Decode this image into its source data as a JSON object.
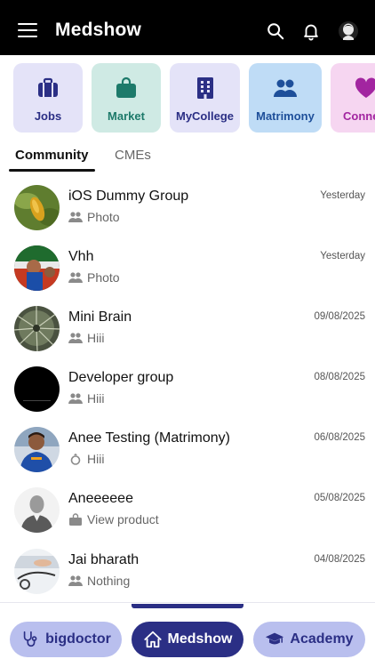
{
  "header": {
    "title": "Medshow",
    "menu_icon": "hamburger-menu-icon",
    "icons": [
      "search-icon",
      "bell-icon",
      "profile-icon"
    ]
  },
  "categories": [
    {
      "label": "Jobs",
      "icon": "briefcase-icon",
      "bg": "#e4e3f8",
      "color": "#2b2f85"
    },
    {
      "label": "Market",
      "icon": "shopping-bag-icon",
      "bg": "#cfeae4",
      "color": "#1d7a6a"
    },
    {
      "label": "MyCollege",
      "icon": "building-icon",
      "bg": "#e4e3f8",
      "color": "#2b2f85"
    },
    {
      "label": "Matrimony",
      "icon": "people-icon",
      "bg": "#bfdcf6",
      "color": "#1e4f9a"
    },
    {
      "label": "Connect",
      "icon": "heart-icon",
      "bg": "#f6d6f1",
      "color": "#a225a0"
    }
  ],
  "tabs": {
    "active": "Community",
    "inactive": "CMEs"
  },
  "chats": [
    {
      "name": "iOS Dummy Group",
      "sub": "Photo",
      "sub_icon": "group-icon",
      "time": "Yesterday"
    },
    {
      "name": "Vhh",
      "sub": "Photo",
      "sub_icon": "group-icon",
      "time": "Yesterday"
    },
    {
      "name": "Mini Brain",
      "sub": "Hiii",
      "sub_icon": "group-icon",
      "time": "09/08/2025"
    },
    {
      "name": "Developer group",
      "sub": "Hiii",
      "sub_icon": "group-icon",
      "time": "08/08/2025"
    },
    {
      "name": "Anee Testing (Matrimony)",
      "sub": "Hiii",
      "sub_icon": "ring-icon",
      "time": "06/08/2025"
    },
    {
      "name": "Aneeeeee",
      "sub": "View product",
      "sub_icon": "shop-icon",
      "time": "05/08/2025"
    },
    {
      "name": "Jai bharath",
      "sub": "Nothing",
      "sub_icon": "group-icon",
      "time": "04/08/2025"
    }
  ],
  "bottom_nav": {
    "bigdoctor": "bigdoctor",
    "medshow": "Medshow",
    "academy": "Academy"
  },
  "colors": {
    "brand": "#2b2f85",
    "header_bg": "#000000"
  }
}
